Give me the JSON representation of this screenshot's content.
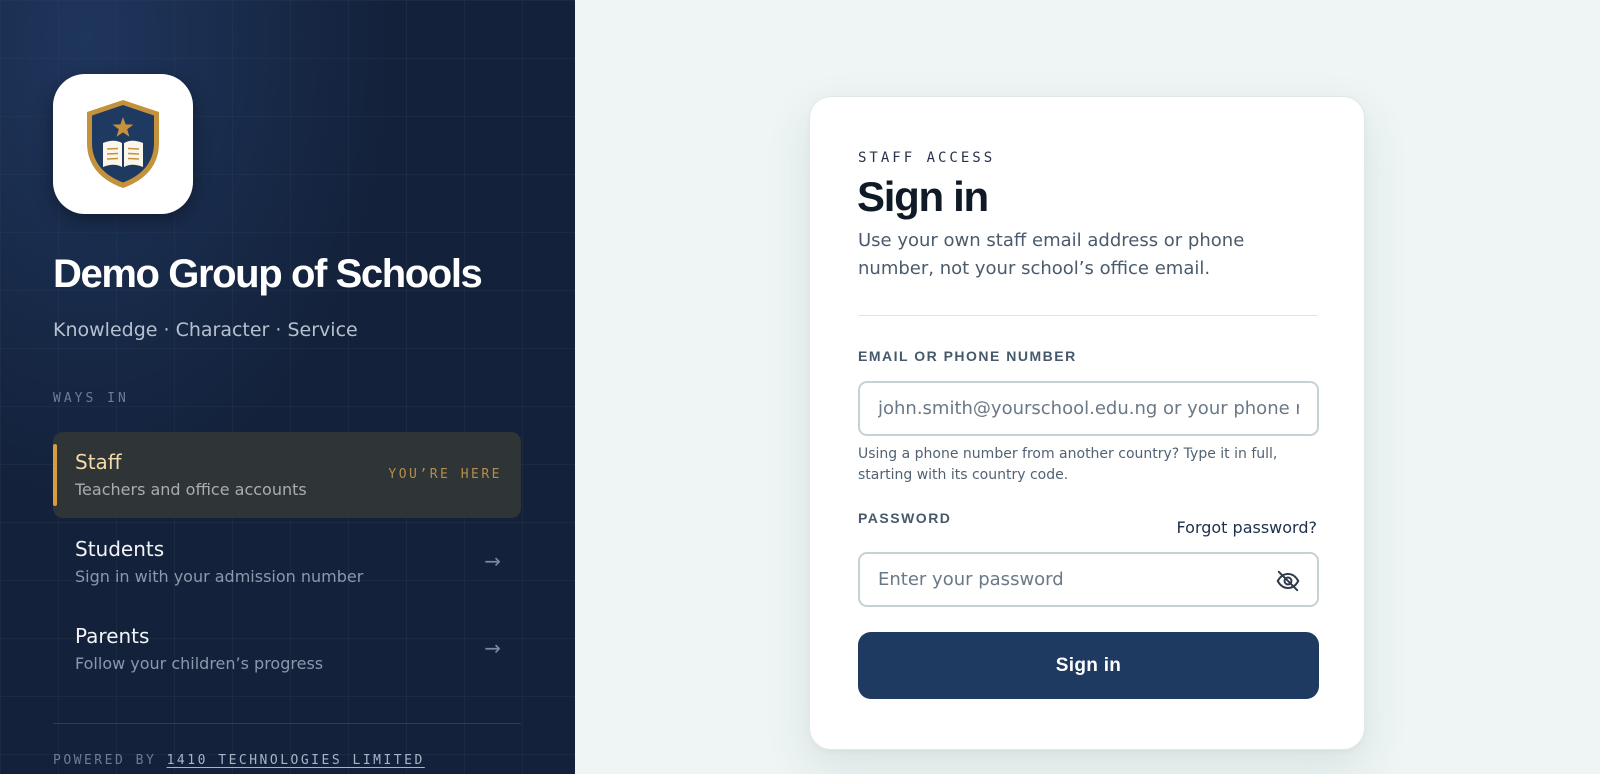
{
  "brand": {
    "school_name": "Demo Group of Schools",
    "tagline": "Knowledge · Character · Service",
    "logo_icon": "shield-book-star-icon",
    "colors": {
      "navy": "#13213a",
      "gold": "#d79e3f",
      "button": "#1f3a60"
    }
  },
  "ways_in": {
    "heading": "WAYS IN",
    "items": [
      {
        "title": "Staff",
        "subtitle": "Teachers and office accounts",
        "badge": "YOU’RE HERE",
        "active": true
      },
      {
        "title": "Students",
        "subtitle": "Sign in with your admission number",
        "icon": "arrow-right-icon",
        "active": false
      },
      {
        "title": "Parents",
        "subtitle": "Follow your children’s progress",
        "icon": "arrow-right-icon",
        "active": false
      }
    ]
  },
  "footer": {
    "powered_label": "POWERED BY",
    "company": "1410 TECHNOLOGIES LIMITED"
  },
  "signin": {
    "eyebrow": "STAFF ACCESS",
    "title": "Sign in",
    "description": "Use your own staff email address or phone number, not your school’s office email.",
    "email_label": "EMAIL OR PHONE NUMBER",
    "email_placeholder": "john.smith@yourschool.edu.ng or your phone number",
    "email_value": "",
    "hint": "Using a phone number from another country? Type it in full, starting with its country code.",
    "password_label": "PASSWORD",
    "forgot": "Forgot password?",
    "password_placeholder": "Enter your password",
    "password_value": "",
    "toggle_icon": "eye-off-icon",
    "submit": "Sign in"
  }
}
